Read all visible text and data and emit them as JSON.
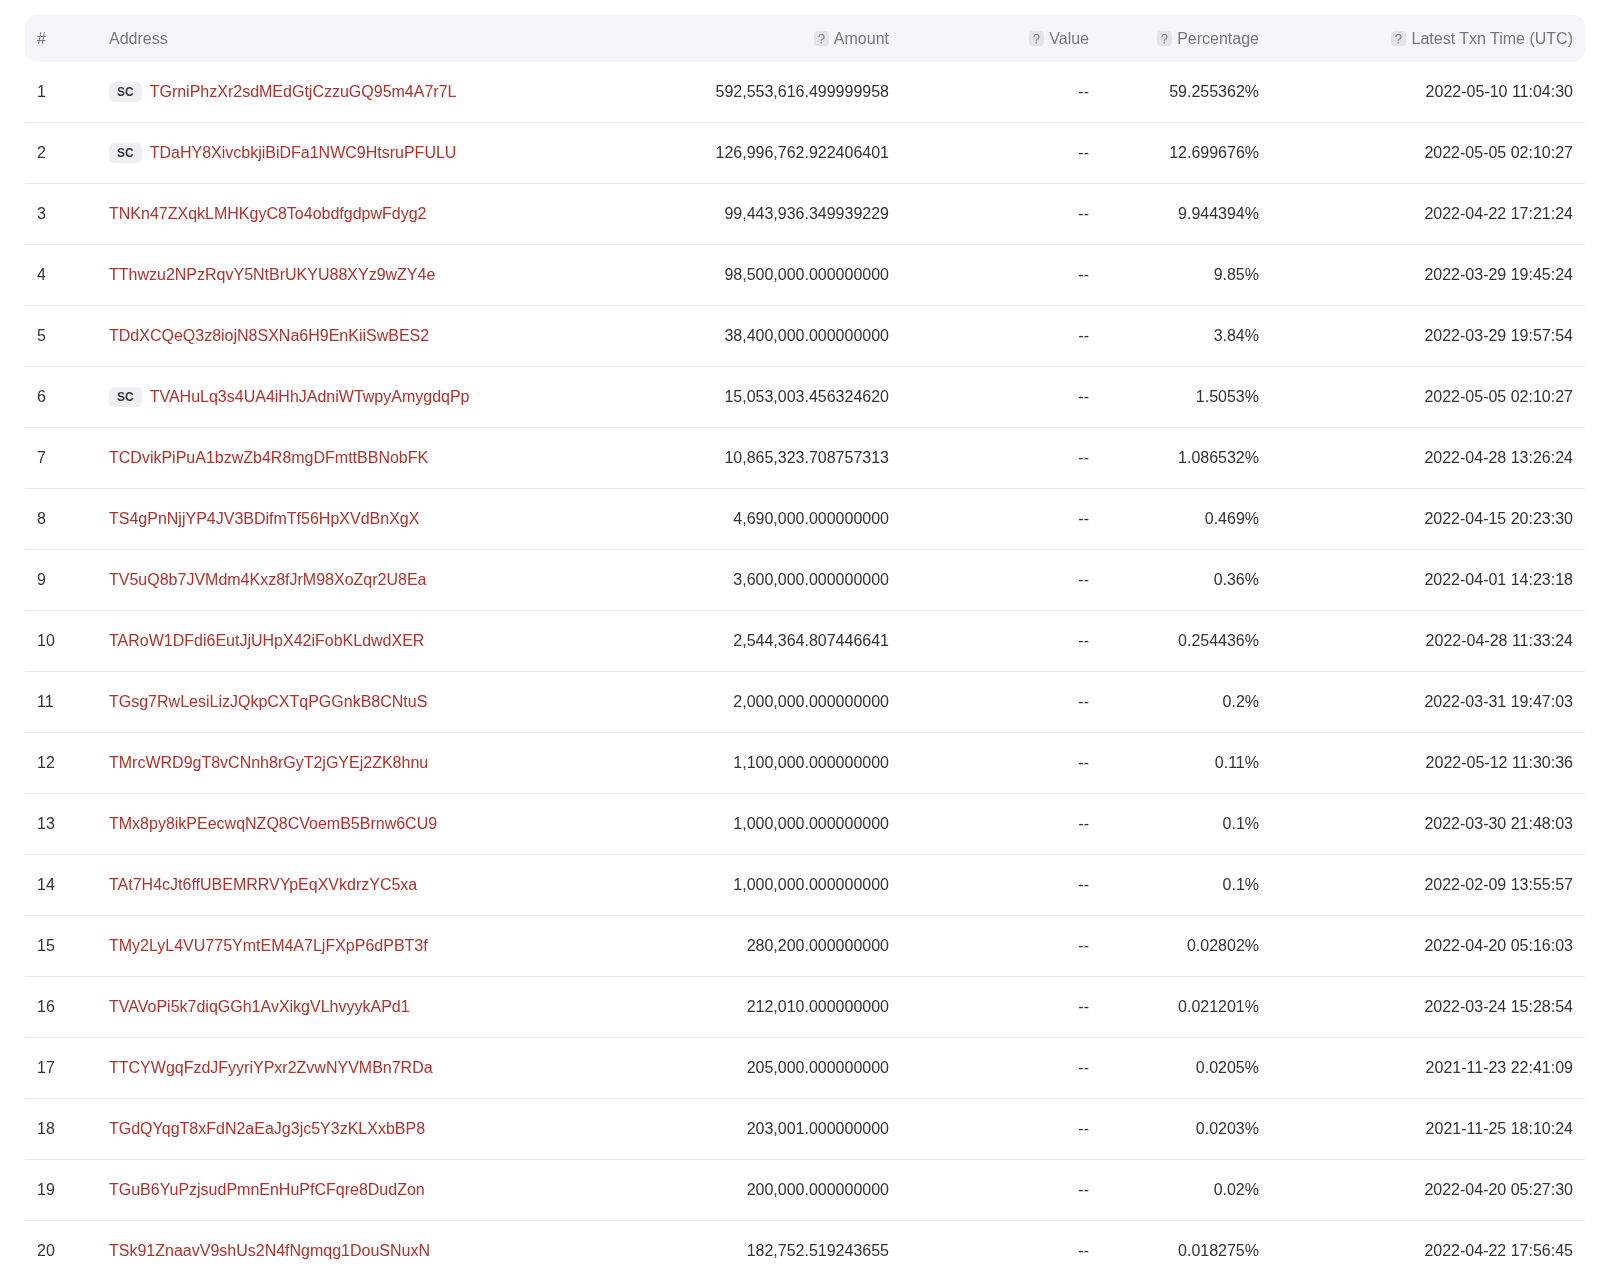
{
  "table": {
    "columns": [
      {
        "label": "#",
        "help": false
      },
      {
        "label": "Address",
        "help": false
      },
      {
        "label": "Amount",
        "help": true
      },
      {
        "label": "Value",
        "help": true
      },
      {
        "label": "Percentage",
        "help": true
      },
      {
        "label": "Latest Txn Time (UTC)",
        "help": true
      }
    ],
    "rows": [
      {
        "rank": "1",
        "badge": "SC",
        "address": "TGrniPhzXr2sdMEdGtjCzzuGQ95m4A7r7L",
        "amount": "592,553,616.499999958",
        "value": "--",
        "percentage": "59.255362%",
        "time": "2022-05-10 11:04:30"
      },
      {
        "rank": "2",
        "badge": "SC",
        "address": "TDaHY8XivcbkjiBiDFa1NWC9HtsruPFULU",
        "amount": "126,996,762.922406401",
        "value": "--",
        "percentage": "12.699676%",
        "time": "2022-05-05 02:10:27"
      },
      {
        "rank": "3",
        "address": "TNKn47ZXqkLMHKgyC8To4obdfgdpwFdyg2",
        "amount": "99,443,936.349939229",
        "value": "--",
        "percentage": "9.944394%",
        "time": "2022-04-22 17:21:24"
      },
      {
        "rank": "4",
        "address": "TThwzu2NPzRqvY5NtBrUKYU88XYz9wZY4e",
        "amount": "98,500,000.000000000",
        "value": "--",
        "percentage": "9.85%",
        "time": "2022-03-29 19:45:24"
      },
      {
        "rank": "5",
        "address": "TDdXCQeQ3z8iojN8SXNa6H9EnKiiSwBES2",
        "amount": "38,400,000.000000000",
        "value": "--",
        "percentage": "3.84%",
        "time": "2022-03-29 19:57:54"
      },
      {
        "rank": "6",
        "badge": "SC",
        "address": "TVAHuLq3s4UA4iHhJAdniWTwpyAmygdqPp",
        "amount": "15,053,003.456324620",
        "value": "--",
        "percentage": "1.5053%",
        "time": "2022-05-05 02:10:27"
      },
      {
        "rank": "7",
        "address": "TCDvikPiPuA1bzwZb4R8mgDFmttBBNobFK",
        "amount": "10,865,323.708757313",
        "value": "--",
        "percentage": "1.086532%",
        "time": "2022-04-28 13:26:24"
      },
      {
        "rank": "8",
        "address": "TS4gPnNjjYP4JV3BDifmTf56HpXVdBnXgX",
        "amount": "4,690,000.000000000",
        "value": "--",
        "percentage": "0.469%",
        "time": "2022-04-15 20:23:30"
      },
      {
        "rank": "9",
        "address": "TV5uQ8b7JVMdm4Kxz8fJrM98XoZqr2U8Ea",
        "amount": "3,600,000.000000000",
        "value": "--",
        "percentage": "0.36%",
        "time": "2022-04-01 14:23:18"
      },
      {
        "rank": "10",
        "address": "TARoW1DFdi6EutJjUHpX42iFobKLdwdXER",
        "amount": "2,544,364.807446641",
        "value": "--",
        "percentage": "0.254436%",
        "time": "2022-04-28 11:33:24"
      },
      {
        "rank": "11",
        "address": "TGsg7RwLesiLizJQkpCXTqPGGnkB8CNtuS",
        "amount": "2,000,000.000000000",
        "value": "--",
        "percentage": "0.2%",
        "time": "2022-03-31 19:47:03"
      },
      {
        "rank": "12",
        "address": "TMrcWRD9gT8vCNnh8rGyT2jGYEj2ZK8hnu",
        "amount": "1,100,000.000000000",
        "value": "--",
        "percentage": "0.11%",
        "time": "2022-05-12 11:30:36"
      },
      {
        "rank": "13",
        "address": "TMx8py8ikPEecwqNZQ8CVoemB5Brnw6CU9",
        "amount": "1,000,000.000000000",
        "value": "--",
        "percentage": "0.1%",
        "time": "2022-03-30 21:48:03"
      },
      {
        "rank": "14",
        "address": "TAt7H4cJt6ffUBEMRRVYpEqXVkdrzYC5xa",
        "amount": "1,000,000.000000000",
        "value": "--",
        "percentage": "0.1%",
        "time": "2022-02-09 13:55:57"
      },
      {
        "rank": "15",
        "address": "TMy2LyL4VU775YmtEM4A7LjFXpP6dPBT3f",
        "amount": "280,200.000000000",
        "value": "--",
        "percentage": "0.02802%",
        "time": "2022-04-20 05:16:03"
      },
      {
        "rank": "16",
        "address": "TVAVoPi5k7diqGGh1AvXikgVLhvyykAPd1",
        "amount": "212,010.000000000",
        "value": "--",
        "percentage": "0.021201%",
        "time": "2022-03-24 15:28:54"
      },
      {
        "rank": "17",
        "address": "TTCYWgqFzdJFyyriYPxr2ZvwNYVMBn7RDa",
        "amount": "205,000.000000000",
        "value": "--",
        "percentage": "0.0205%",
        "time": "2021-11-23 22:41:09"
      },
      {
        "rank": "18",
        "address": "TGdQYqgT8xFdN2aEaJg3jc5Y3zKLXxbBP8",
        "amount": "203,001.000000000",
        "value": "--",
        "percentage": "0.0203%",
        "time": "2021-11-25 18:10:24"
      },
      {
        "rank": "19",
        "address": "TGuB6YuPzjsudPmnEnHuPfCFqre8DudZon",
        "amount": "200,000.000000000",
        "value": "--",
        "percentage": "0.02%",
        "time": "2022-04-20 05:27:30"
      },
      {
        "rank": "20",
        "address": "TSk91ZnaavV9shUs2N4fNgmqg1DouSNuxN",
        "amount": "182,752.519243655",
        "value": "--",
        "percentage": "0.018275%",
        "time": "2022-04-22 17:56:45"
      }
    ]
  }
}
